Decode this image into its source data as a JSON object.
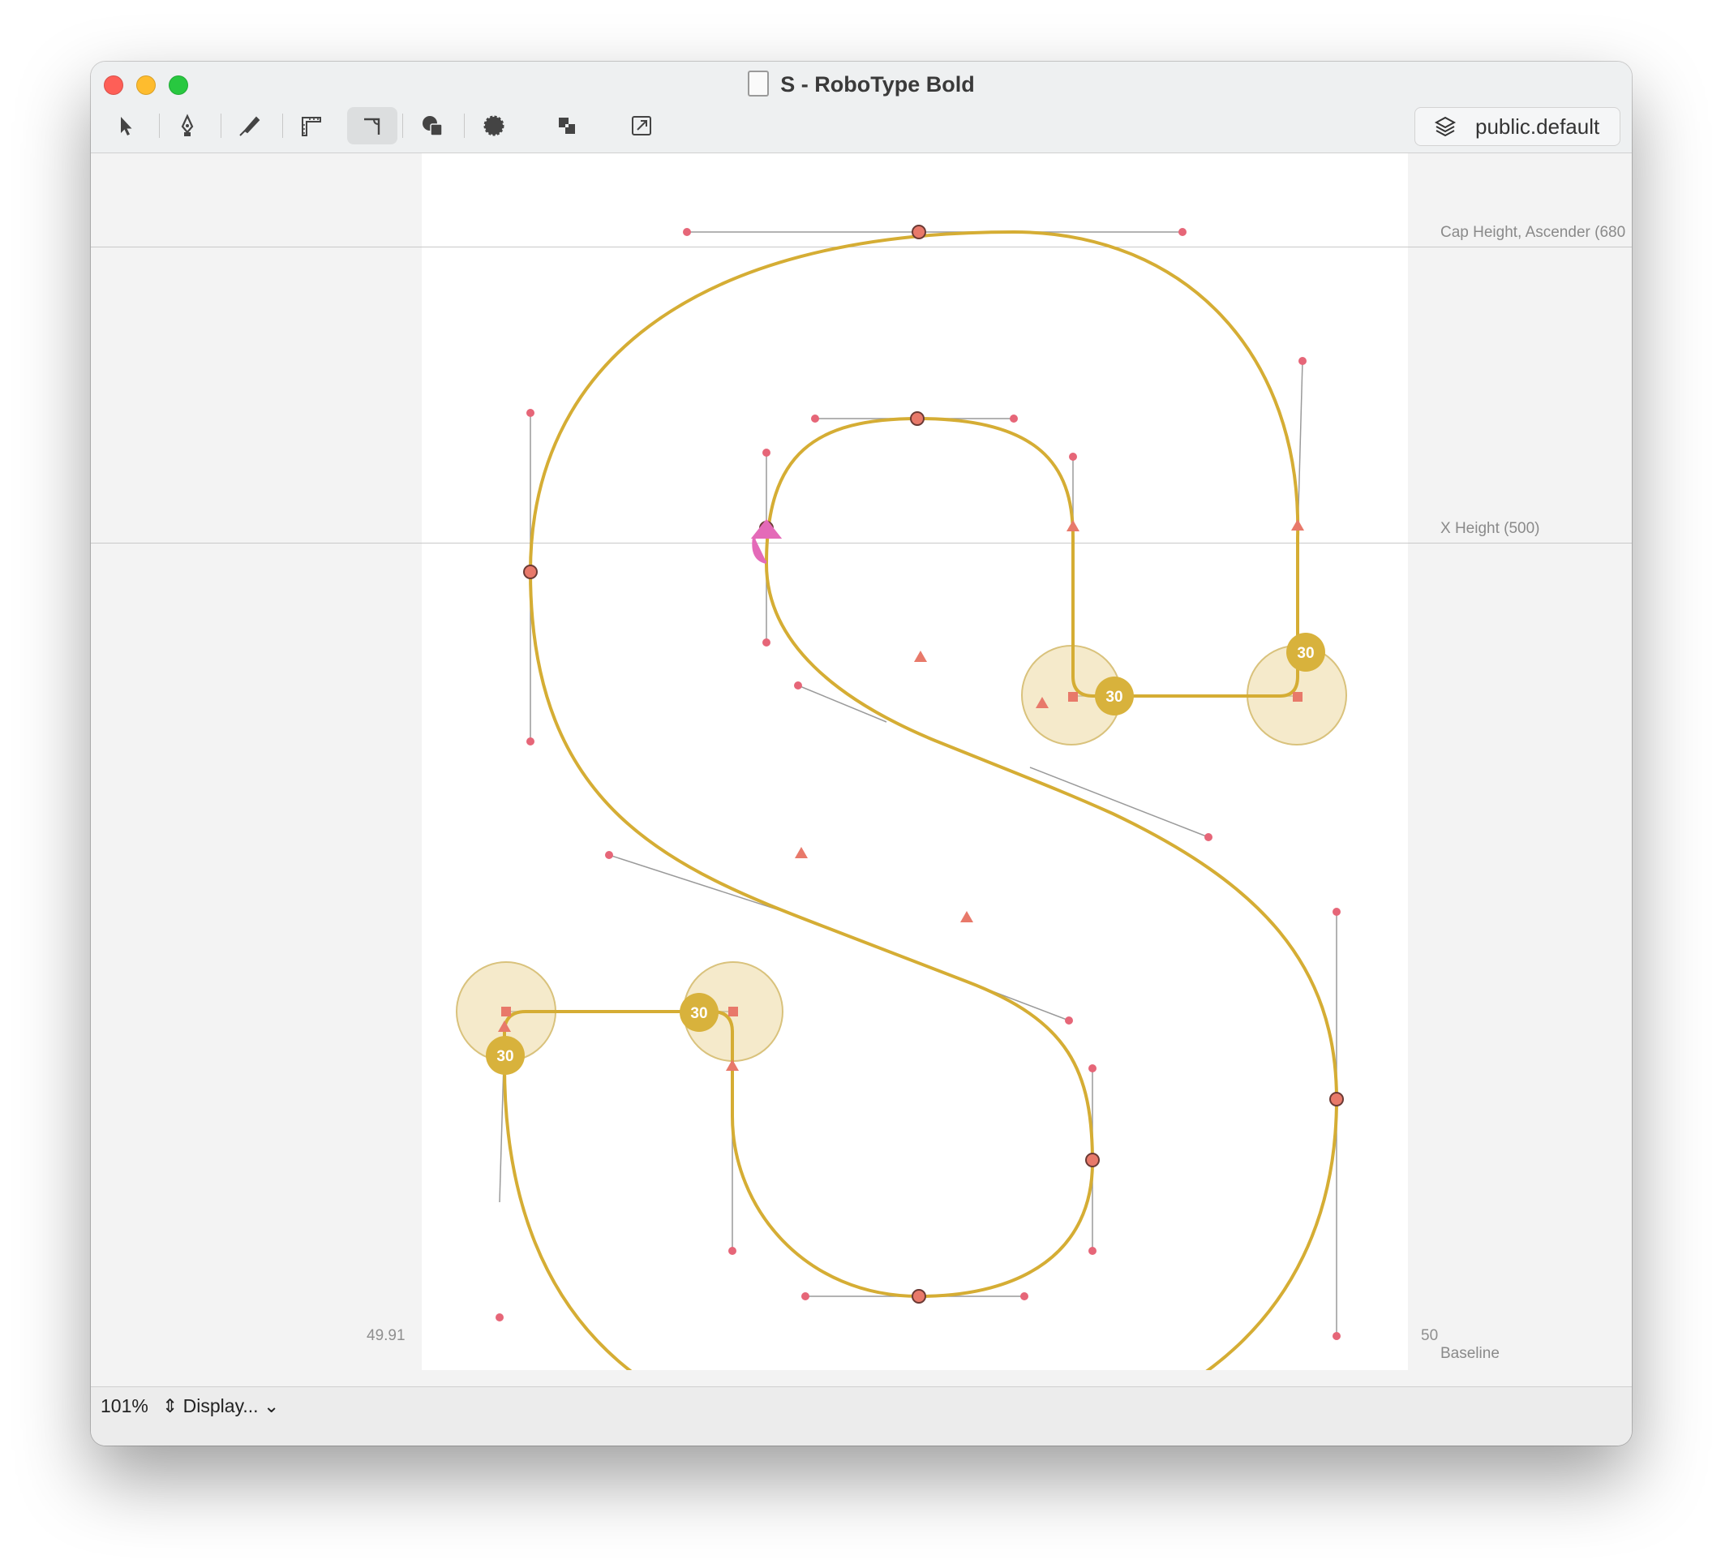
{
  "window": {
    "title": "S - RoboType Bold"
  },
  "toolbar": {
    "tools": [
      {
        "name": "pointer-tool",
        "icon": "arrow-pointer-icon"
      },
      {
        "name": "pen-tool",
        "icon": "pen-nib-icon"
      },
      {
        "name": "knife-tool",
        "icon": "knife-icon"
      },
      {
        "name": "measure-tool",
        "icon": "ruler-icon"
      },
      {
        "name": "corner-tool",
        "icon": "corner-icon",
        "active": true
      },
      {
        "name": "shapes-tool",
        "icon": "shapes-icon"
      },
      {
        "name": "outline-tool",
        "icon": "dashed-circle-icon"
      },
      {
        "name": "overlap-tool",
        "icon": "overlap-squares-icon"
      },
      {
        "name": "transform-tool",
        "icon": "transform-icon"
      }
    ],
    "layer_label": "public.default"
  },
  "metrics": {
    "cap_height_label": "Cap Height, Ascender (680",
    "x_height_label": "X Height (500)",
    "baseline_label": "Baseline"
  },
  "sidebearings": {
    "left": "49.91",
    "right": "50"
  },
  "corner_badges": [
    "30",
    "30",
    "30",
    "30"
  ],
  "status": {
    "zoom": "101%",
    "display_label": "Display..."
  },
  "colors": {
    "outline": "#d9b13a",
    "point": "#e46f5c",
    "handle": "#e66678",
    "badge": "#d8b23c"
  }
}
